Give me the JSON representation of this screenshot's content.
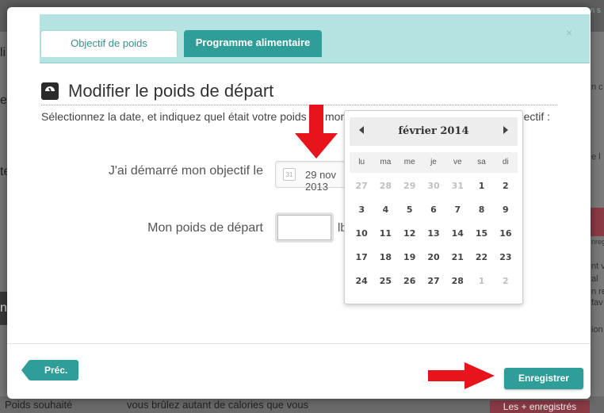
{
  "background": {
    "top_link": "un s",
    "left_fragments": [
      "li",
      "ez",
      "te",
      "ne"
    ],
    "right_fragments": [
      "n c",
      "e l",
      "nregist",
      "nt v",
      "al",
      "n re",
      "fav",
      "ion"
    ],
    "bottom_left_text": "Poids souhaité",
    "bottom_center_text": "vous brûlez autant de calories que vous",
    "bottom_button": "Les + enregistrés"
  },
  "modal": {
    "close_label": "×",
    "tabs": [
      {
        "label": "Objectif de poids",
        "active": true
      },
      {
        "label": "Programme alimentaire",
        "active": false
      }
    ],
    "title": "Modifier le poids de départ",
    "instructions": "Sélectionnez la date, et indiquez quel était votre poids au moment où vous avez démarré votre objectif :",
    "start_label": "J'ai démarré mon objectif le",
    "calendar_icon_text": "31",
    "start_date_value": "29 nov 2013",
    "weight_label": "Mon poids de départ",
    "weight_value": "",
    "weight_unit": "lb",
    "prev_button": "Préc.",
    "save_button": "Enregistrer"
  },
  "datepicker": {
    "month": "février 2014",
    "weekdays": [
      "lu",
      "ma",
      "me",
      "je",
      "ve",
      "sa",
      "di"
    ],
    "days": [
      {
        "n": "27",
        "other": true
      },
      {
        "n": "28",
        "other": true
      },
      {
        "n": "29",
        "other": true
      },
      {
        "n": "30",
        "other": true
      },
      {
        "n": "31",
        "other": true
      },
      {
        "n": "1",
        "other": false
      },
      {
        "n": "2",
        "other": false
      },
      {
        "n": "3",
        "other": false
      },
      {
        "n": "4",
        "other": false
      },
      {
        "n": "5",
        "other": false
      },
      {
        "n": "6",
        "other": false
      },
      {
        "n": "7",
        "other": false
      },
      {
        "n": "8",
        "other": false
      },
      {
        "n": "9",
        "other": false
      },
      {
        "n": "10",
        "other": false
      },
      {
        "n": "11",
        "other": false
      },
      {
        "n": "12",
        "other": false
      },
      {
        "n": "13",
        "other": false
      },
      {
        "n": "14",
        "other": false
      },
      {
        "n": "15",
        "other": false
      },
      {
        "n": "16",
        "other": false
      },
      {
        "n": "17",
        "other": false
      },
      {
        "n": "18",
        "other": false
      },
      {
        "n": "19",
        "other": false
      },
      {
        "n": "20",
        "other": false
      },
      {
        "n": "21",
        "other": false
      },
      {
        "n": "22",
        "other": false
      },
      {
        "n": "23",
        "other": false
      },
      {
        "n": "24",
        "other": false
      },
      {
        "n": "25",
        "other": false
      },
      {
        "n": "26",
        "other": false
      },
      {
        "n": "27",
        "other": false
      },
      {
        "n": "28",
        "other": false
      },
      {
        "n": "1",
        "other": true
      },
      {
        "n": "2",
        "other": true
      }
    ]
  },
  "colors": {
    "accent": "#2f9e99",
    "header_bg": "#b5e3e1",
    "annotation_arrow": "#e8141c"
  }
}
